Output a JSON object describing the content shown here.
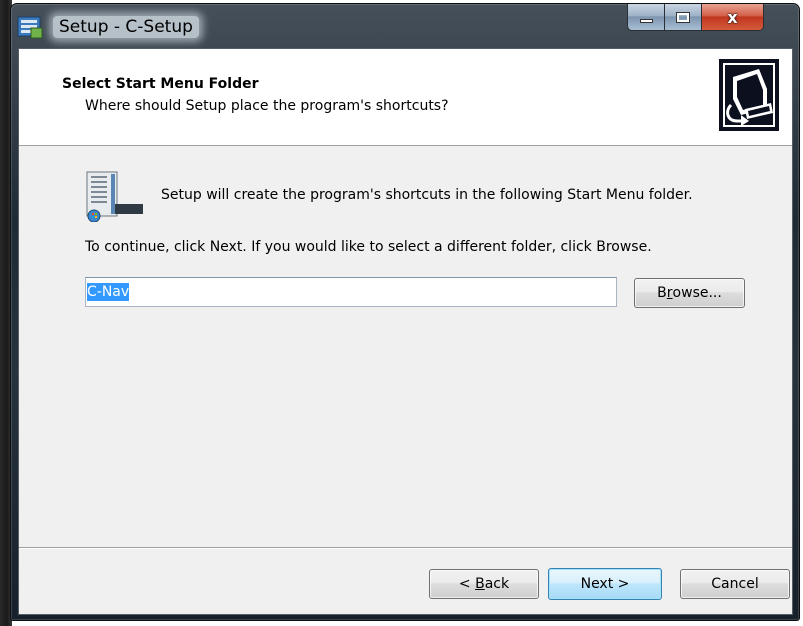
{
  "window": {
    "title": "Setup - C-Setup",
    "close_glyph": "x"
  },
  "header": {
    "title": "Select Start Menu Folder",
    "subtitle": "Where should Setup place the program's shortcuts?"
  },
  "body": {
    "intro": "Setup will create the program's shortcuts in the following Start Menu folder.",
    "instruction": "To continue, click Next. If you would like to select a different folder, click Browse."
  },
  "folder": {
    "value": "C-Nav"
  },
  "buttons": {
    "browse_pre": "B",
    "browse_mnemonic": "r",
    "browse_post": "owse...",
    "back_pre": "< ",
    "back_mnemonic": "B",
    "back_post": "ack",
    "next": "Next >",
    "cancel": "Cancel"
  },
  "colors": {
    "selection": "#3399ff",
    "dialog_bg": "#f0f0f0",
    "close_button": "#c0371f"
  },
  "icons": {
    "app": "setup-installer-icon",
    "header": "computer-install-icon",
    "folder": "start-menu-folder-icon",
    "minimize": "minimize-icon",
    "maximize": "maximize-icon",
    "close": "close-icon"
  }
}
